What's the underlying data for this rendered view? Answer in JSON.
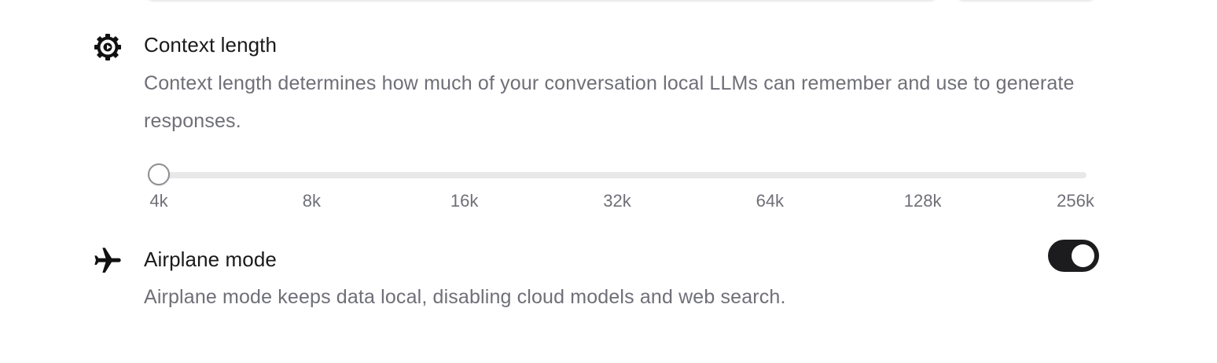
{
  "context_length": {
    "icon": "cog-icon",
    "title": "Context length",
    "description": "Context length determines how much of your conversation local LLMs can remember and use to generate responses.",
    "slider": {
      "options": [
        "4k",
        "8k",
        "16k",
        "32k",
        "64k",
        "128k",
        "256k"
      ],
      "selected_index": 0,
      "selected": "4k"
    }
  },
  "airplane_mode": {
    "icon": "airplane-icon",
    "title": "Airplane mode",
    "description": "Airplane mode keeps data local, disabling cloud models and web search.",
    "enabled": true
  },
  "colors": {
    "toggle_on": "#1c1c1e",
    "description_text": "#6f6f78",
    "track": "#e8e8e8"
  }
}
